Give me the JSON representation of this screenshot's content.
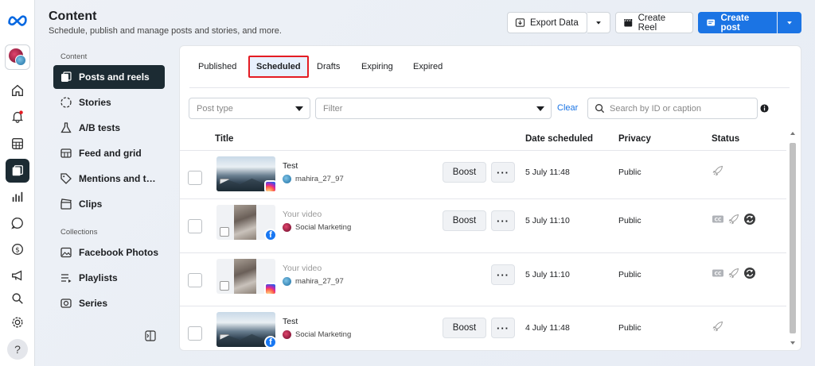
{
  "header": {
    "title": "Content",
    "subtitle": "Schedule, publish and manage posts and stories, and more.",
    "export_label": "Export Data",
    "create_reel_label": "Create Reel",
    "create_post_label": "Create post"
  },
  "sidebar": {
    "content_heading": "Content",
    "collections_heading": "Collections",
    "items": [
      {
        "label": "Posts and reels",
        "active": true
      },
      {
        "label": "Stories"
      },
      {
        "label": "A/B tests"
      },
      {
        "label": "Feed and grid"
      },
      {
        "label": "Mentions and t…"
      },
      {
        "label": "Clips"
      }
    ],
    "collections": [
      {
        "label": "Facebook Photos"
      },
      {
        "label": "Playlists"
      },
      {
        "label": "Series"
      }
    ]
  },
  "tabs": [
    "Published",
    "Scheduled",
    "Drafts",
    "Expiring",
    "Expired"
  ],
  "active_tab": "Scheduled",
  "filters": {
    "post_type_placeholder": "Post type",
    "filter_placeholder": "Filter",
    "clear_label": "Clear",
    "search_placeholder": "Search by ID or caption"
  },
  "table": {
    "columns": [
      "Title",
      "Date scheduled",
      "Privacy",
      "Status"
    ],
    "boost_label": "Boost",
    "rows": [
      {
        "title": "Test",
        "account": "mahira_27_97",
        "platform": "instagram",
        "date": "5 July 11:48",
        "privacy": "Public",
        "boost": true
      },
      {
        "title": "Your video",
        "account": "Social Marketing",
        "platform": "facebook",
        "date": "5 July 11:10",
        "privacy": "Public",
        "boost": true
      },
      {
        "title": "Your video",
        "account": "mahira_27_97",
        "platform": "instagram",
        "date": "5 July 11:10",
        "privacy": "Public",
        "boost": false
      },
      {
        "title": "Test",
        "account": "Social Marketing",
        "platform": "facebook",
        "date": "4 July 11:48",
        "privacy": "Public",
        "boost": true
      }
    ]
  },
  "colors": {
    "primary": "#1b74e4",
    "nav_active": "#1c2b33",
    "highlight_border": "#e41b23"
  }
}
